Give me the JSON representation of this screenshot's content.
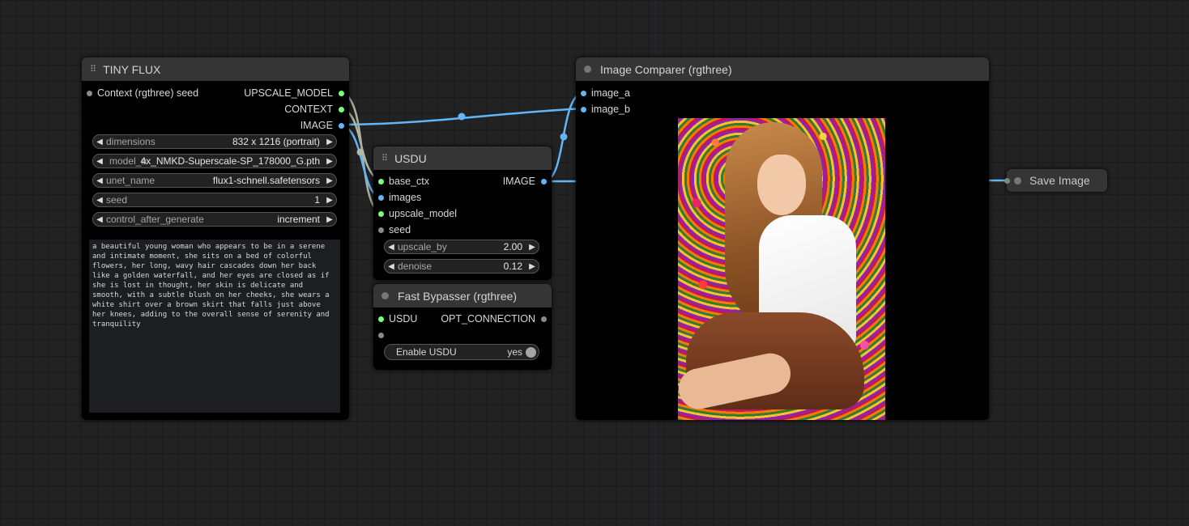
{
  "nodes": {
    "tiny_flux": {
      "title": "TINY FLUX",
      "input_label": "Context (rgthree) seed",
      "outputs": [
        "UPSCALE_MODEL",
        "CONTEXT",
        "IMAGE"
      ],
      "widgets": {
        "dimensions": {
          "label": "dimensions",
          "value": "832 x 1216  (portrait)"
        },
        "model_name": {
          "label": "model_n",
          "value": "4x_NMKD-Superscale-SP_178000_G.pth"
        },
        "unet_name": {
          "label": "unet_name",
          "value": "flux1-schnell.safetensors"
        },
        "seed": {
          "label": "seed",
          "value": "1"
        },
        "control_after_generate": {
          "label": "control_after_generate",
          "value": "increment"
        }
      },
      "prompt": "a beautiful young woman who appears to be in a serene and intimate moment, she sits on a bed of colorful flowers, her long, wavy hair cascades down her back like a golden waterfall, and her eyes are closed as if she is lost in thought, her skin is delicate and smooth, with a subtle blush on her cheeks, she wears a white shirt over a brown skirt that falls just above her knees, adding to the overall sense of serenity and tranquility"
    },
    "usdu": {
      "title": "USDU",
      "inputs": [
        "base_ctx",
        "images",
        "upscale_model",
        "seed"
      ],
      "output": "IMAGE",
      "widgets": {
        "upscale_by": {
          "label": "upscale_by",
          "value": "2.00"
        },
        "denoise": {
          "label": "denoise",
          "value": "0.12"
        }
      }
    },
    "fast_bypasser": {
      "title": "Fast Bypasser (rgthree)",
      "input": "USDU",
      "output": "OPT_CONNECTION",
      "toggle": {
        "label": "Enable USDU",
        "value": "yes"
      }
    },
    "image_comparer": {
      "title": "Image Comparer (rgthree)",
      "inputs": [
        "image_a",
        "image_b"
      ]
    },
    "save_image": {
      "title": "Save Image"
    }
  },
  "colors": {
    "canvas": "#222222",
    "node_body": "#000000",
    "node_header": "#353535",
    "link_image": "#64b5f6",
    "link_model": "#7dff7d",
    "link_context": "#b0b8a8"
  },
  "icons": {
    "grip": "grip-dots-icon",
    "arrow_left": "triangle-left-icon",
    "arrow_right": "triangle-right-icon"
  }
}
